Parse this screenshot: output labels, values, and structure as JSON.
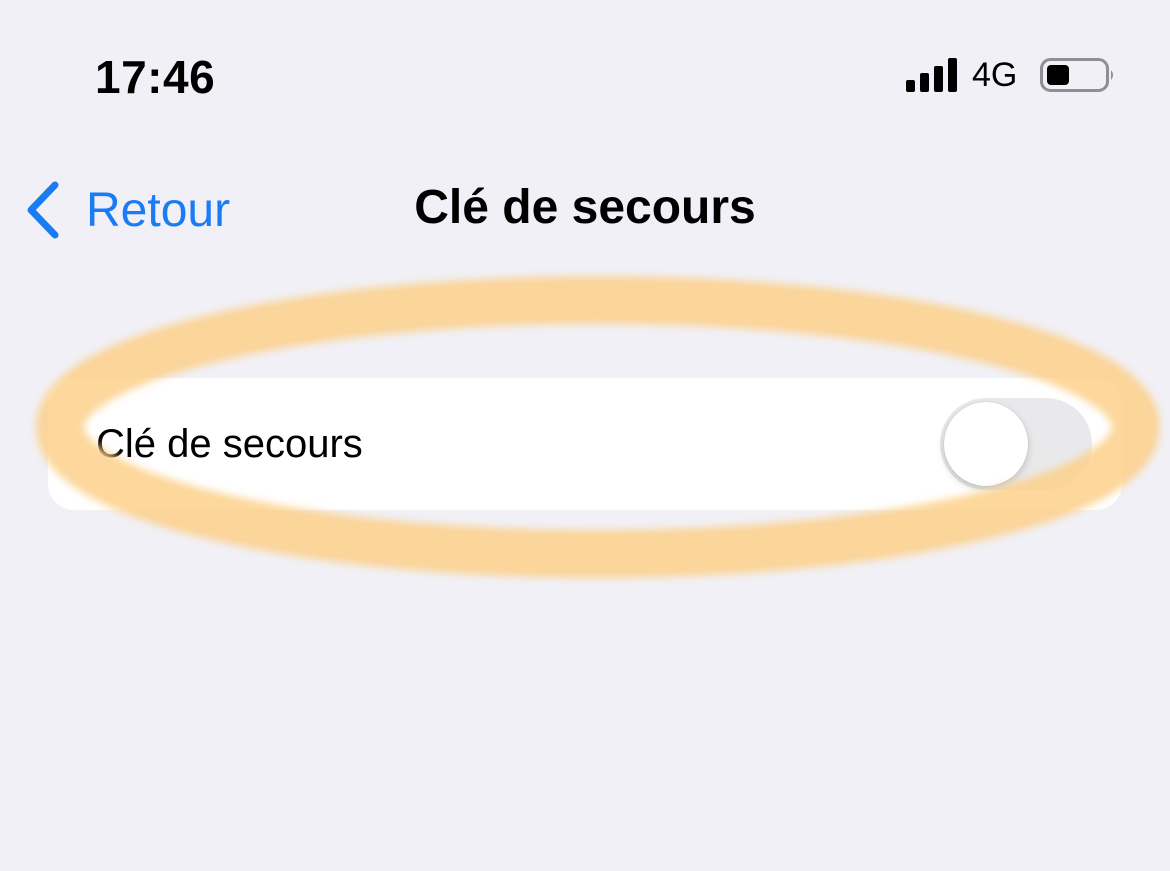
{
  "status_bar": {
    "time": "17:46",
    "network": "4G",
    "signal_icon": "signal-bars-icon",
    "battery_icon": "battery-low-icon",
    "battery_level": 0.3
  },
  "nav": {
    "back_label": "Retour",
    "back_icon": "chevron-left-icon",
    "title": "Clé de secours"
  },
  "settings": {
    "rows": [
      {
        "label": "Clé de secours",
        "toggle_on": false
      }
    ]
  },
  "colors": {
    "accent": "#1a7cf5",
    "background": "#f1f0f6",
    "highlight": "#fdd594"
  }
}
